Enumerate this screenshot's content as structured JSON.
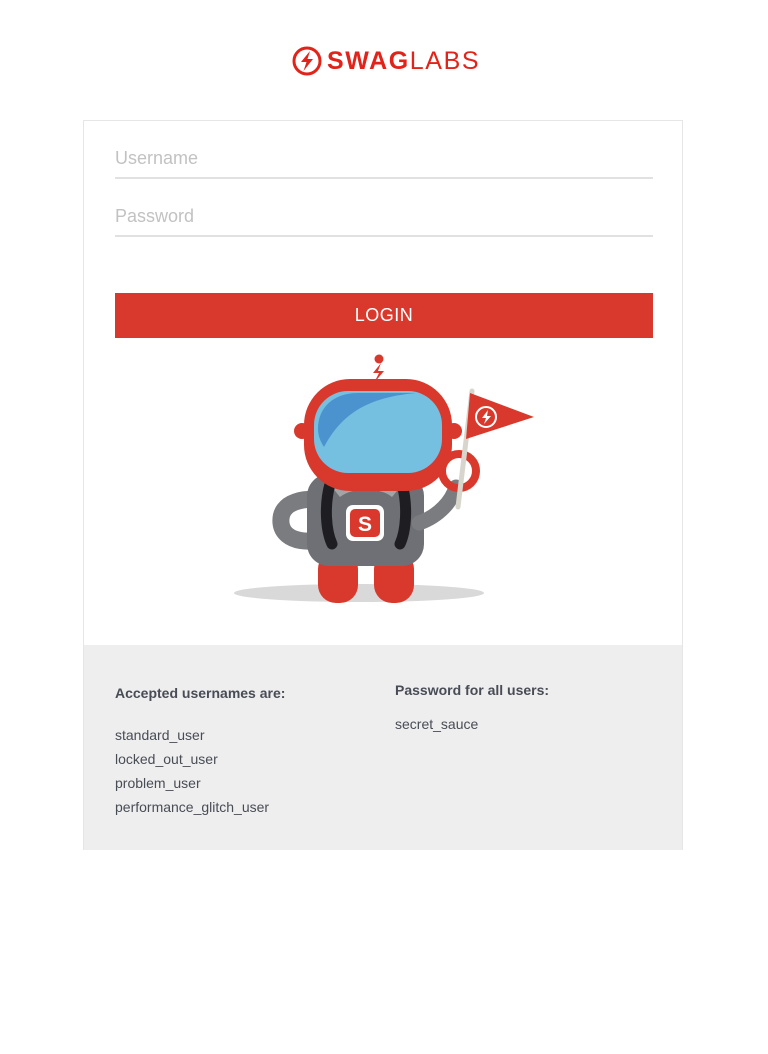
{
  "app": {
    "brand_primary": "SWAG",
    "brand_secondary": "LABS",
    "accent_color": "#e2231a",
    "button_color": "#d9392c",
    "logo_icon": "swag-labs-logo-icon"
  },
  "login_form": {
    "username": {
      "placeholder": "Username",
      "value": ""
    },
    "password": {
      "placeholder": "Password",
      "value": ""
    },
    "submit_label": "LOGIN",
    "illustration": "robot-mascot-with-flag"
  },
  "credentials": {
    "usernames_heading": "Accepted usernames are:",
    "usernames": [
      "standard_user",
      "locked_out_user",
      "problem_user",
      "performance_glitch_user"
    ],
    "password_heading": "Password for all users:",
    "passwords": [
      "secret_sauce"
    ]
  }
}
